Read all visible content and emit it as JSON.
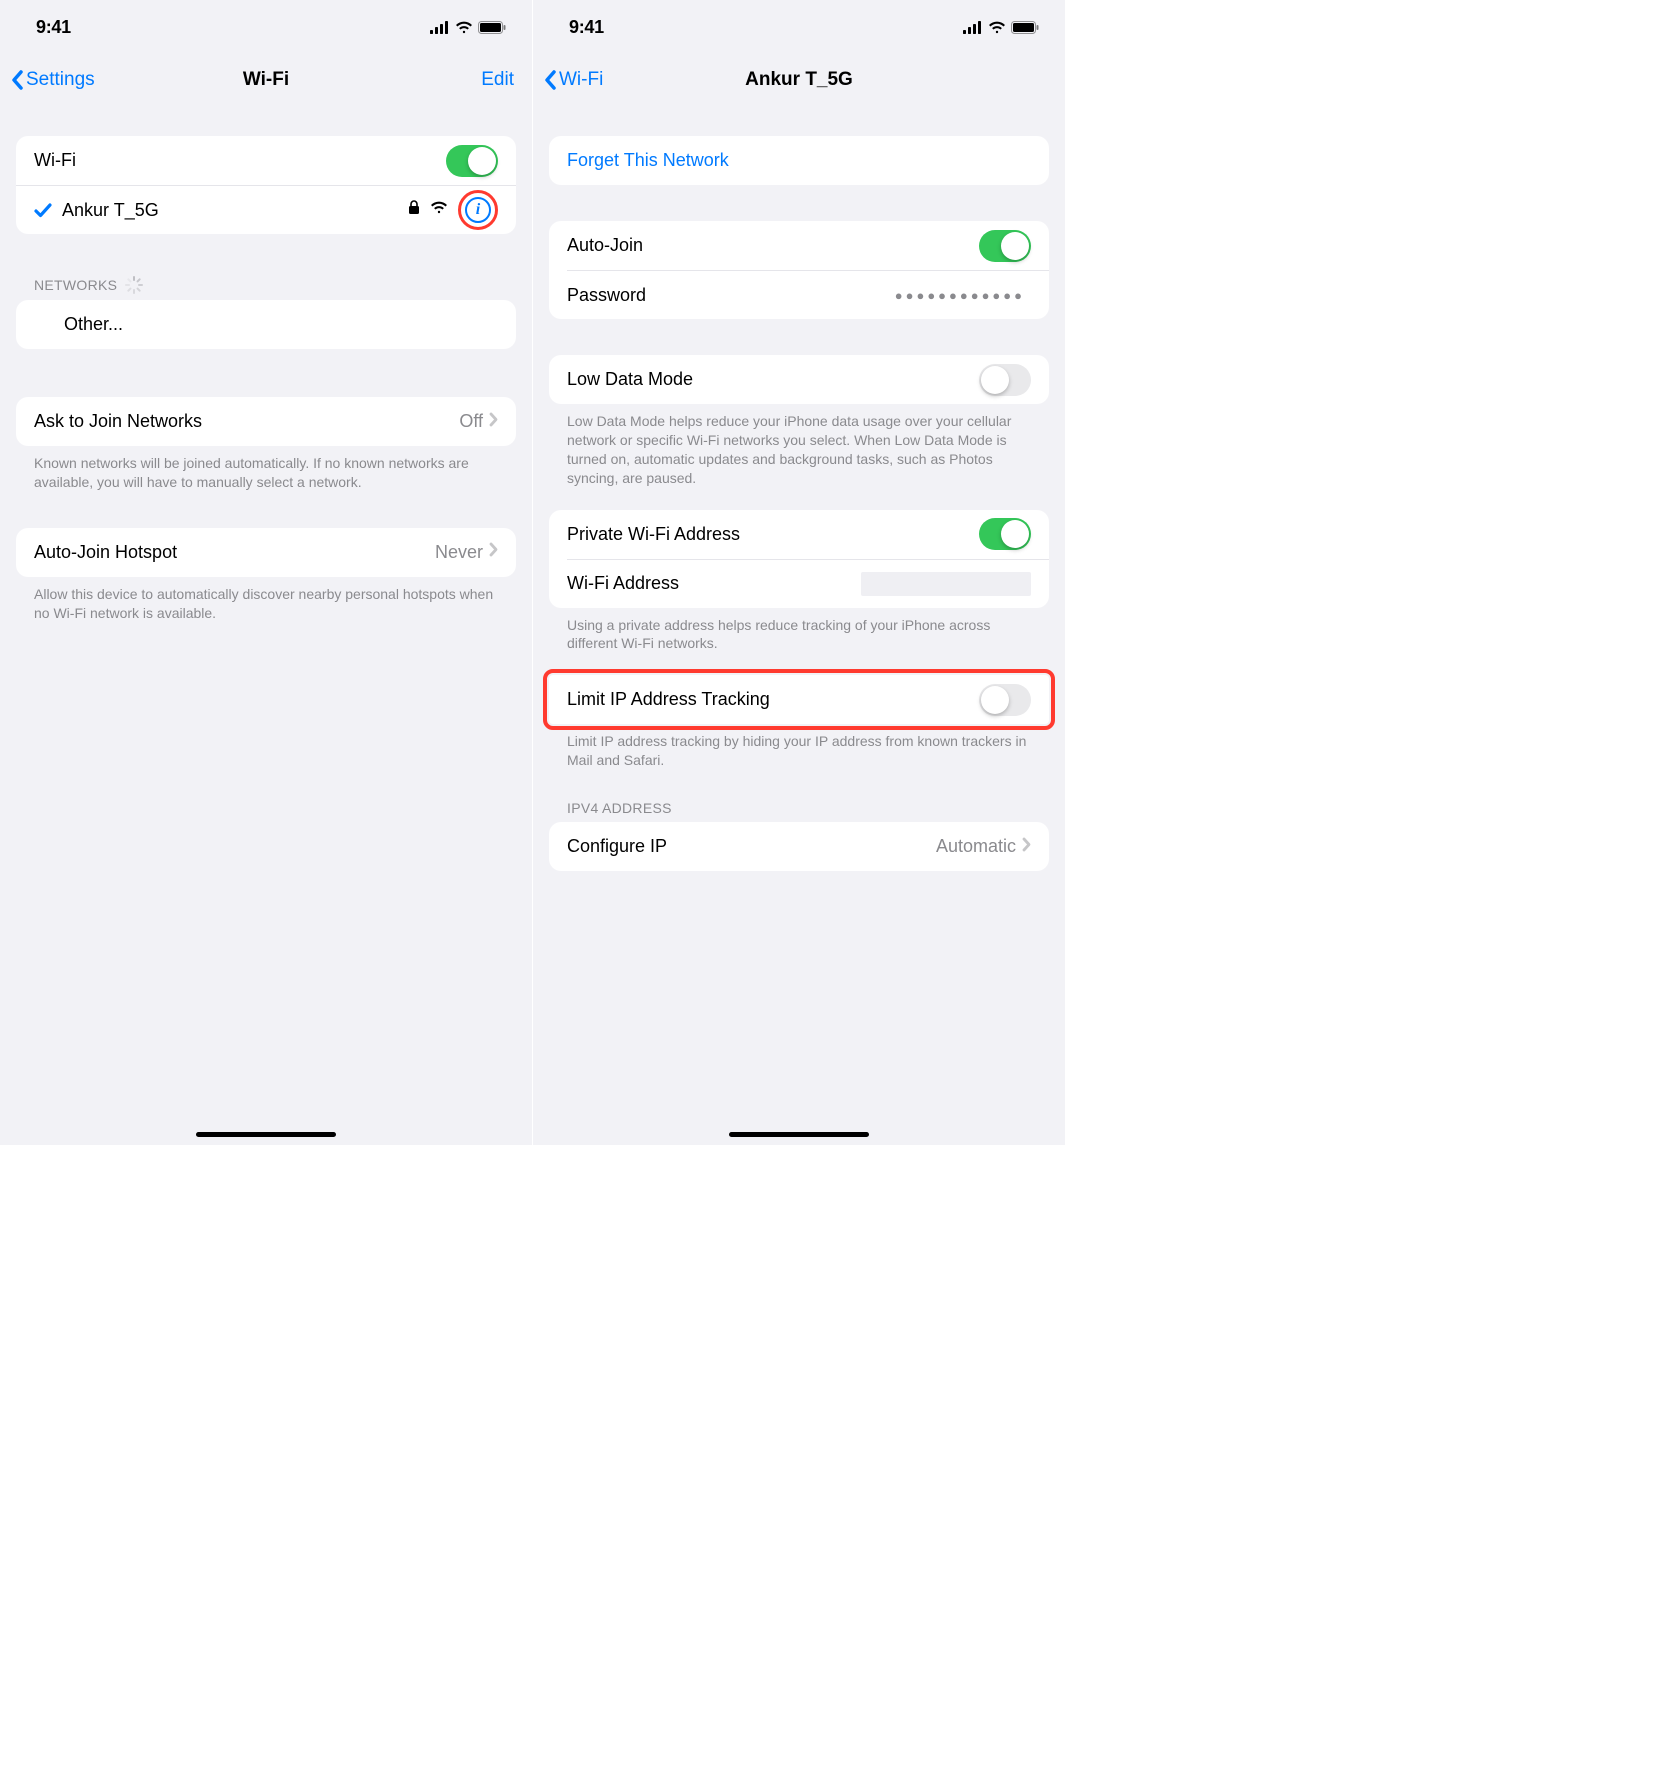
{
  "status": {
    "time": "9:41"
  },
  "left": {
    "back": "Settings",
    "title": "Wi-Fi",
    "edit": "Edit",
    "wifi_label": "Wi-Fi",
    "wifi_on": true,
    "connected_name": "Ankur T_5G",
    "networks_header": "NETWORKS",
    "other_label": "Other...",
    "ask_join_label": "Ask to Join Networks",
    "ask_join_value": "Off",
    "ask_join_footer": "Known networks will be joined automatically. If no known networks are available, you will have to manually select a network.",
    "autojoin_hotspot_label": "Auto-Join Hotspot",
    "autojoin_hotspot_value": "Never",
    "autojoin_hotspot_footer": "Allow this device to automatically discover nearby personal hotspots when no Wi-Fi network is available."
  },
  "right": {
    "back": "Wi-Fi",
    "title": "Ankur T_5G",
    "forget_label": "Forget This Network",
    "autojoin_label": "Auto-Join",
    "autojoin_on": true,
    "password_label": "Password",
    "password_mask": "●●●●●●●●●●●●",
    "lowdata_label": "Low Data Mode",
    "lowdata_on": false,
    "lowdata_footer": "Low Data Mode helps reduce your iPhone data usage over your cellular network or specific Wi-Fi networks you select. When Low Data Mode is turned on, automatic updates and background tasks, such as Photos syncing, are paused.",
    "private_label": "Private Wi-Fi Address",
    "private_on": true,
    "wifi_addr_label": "Wi-Fi Address",
    "wifi_addr_value": "",
    "private_footer": "Using a private address helps reduce tracking of your iPhone across different Wi-Fi networks.",
    "limit_ip_label": "Limit IP Address Tracking",
    "limit_ip_on": false,
    "limit_ip_footer": "Limit IP address tracking by hiding your IP address from known trackers in Mail and Safari.",
    "ipv4_header": "IPV4 ADDRESS",
    "configure_ip_label": "Configure IP",
    "configure_ip_value": "Automatic"
  }
}
